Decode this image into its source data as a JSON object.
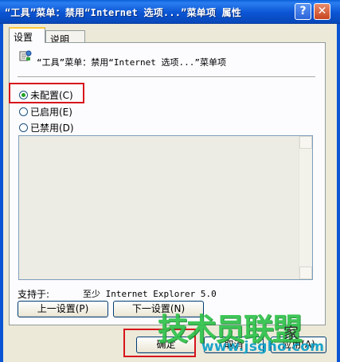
{
  "window": {
    "title": "“工具”菜单：禁用“Internet 选项...”菜单项 属性",
    "help_label": "?",
    "close_label": "✕"
  },
  "tabs": [
    {
      "label": "设置",
      "active": true
    },
    {
      "label": "说明",
      "active": false
    }
  ],
  "policy": {
    "icon": "policy-setting-icon",
    "title": "“工具”菜单：禁用“Internet 选项...”菜单项"
  },
  "options": [
    {
      "label": "未配置(C)",
      "selected": true
    },
    {
      "label": "已启用(E)",
      "selected": false
    },
    {
      "label": "已禁用(D)",
      "selected": false
    }
  ],
  "support": {
    "label": "支持于:",
    "value": "至少 Internet Explorer 5.0"
  },
  "buttons": {
    "prev": "上一设置(P)",
    "next": "下一设置(N)",
    "ok": "确定",
    "cancel": "取消",
    "apply": "应用(A)"
  },
  "watermark": {
    "logo": "技术员联盟",
    "home": "家",
    "url": "www.jsgho.com"
  },
  "colors": {
    "highlight_box": "#d8141b",
    "titlebar": "#0b55d4",
    "watermark_green": "#2fc24b"
  }
}
